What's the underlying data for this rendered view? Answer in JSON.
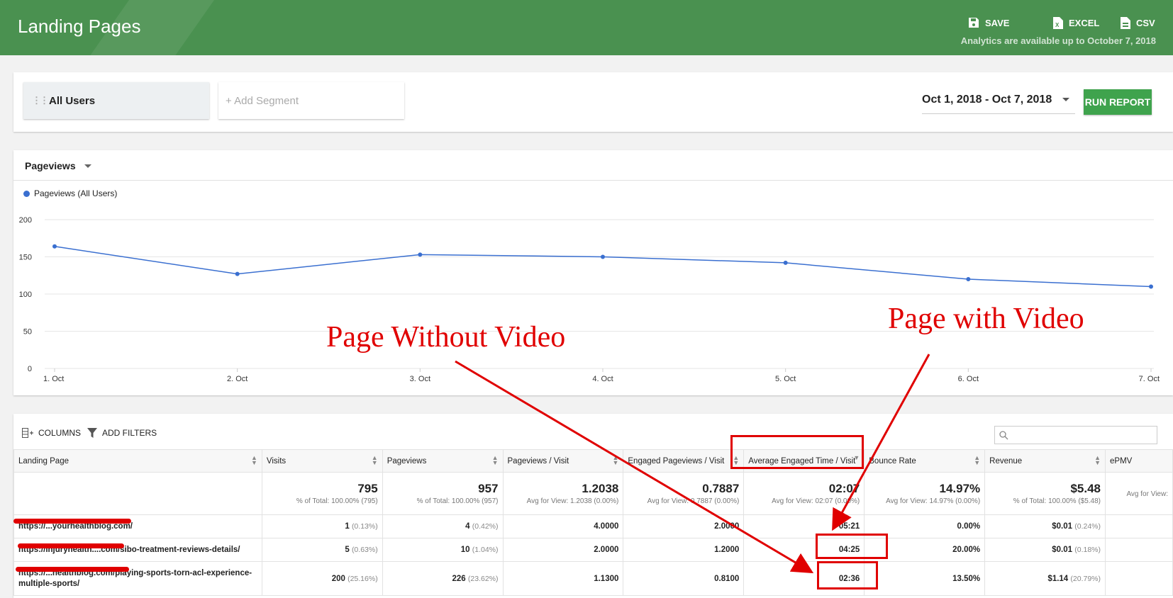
{
  "header": {
    "title": "Landing Pages",
    "save_label": "SAVE",
    "excel_label": "EXCEL",
    "csv_label": "CSV",
    "availability": "Analytics are available up to October 7, 2018"
  },
  "segments": {
    "active": "All Users",
    "add": "+ Add Segment"
  },
  "date_range": "Oct 1, 2018 - Oct 7, 2018",
  "run_report_label": "RUN REPORT",
  "chart_panel": {
    "metric": "Pageviews",
    "legend": "Pageviews (All Users)"
  },
  "chart_data": {
    "type": "line",
    "categories": [
      "1. Oct",
      "2. Oct",
      "3. Oct",
      "4. Oct",
      "5. Oct",
      "6. Oct",
      "7. Oct"
    ],
    "series": [
      {
        "name": "Pageviews (All Users)",
        "values": [
          164,
          127,
          153,
          150,
          142,
          120,
          110
        ],
        "color": "#3a6fd0"
      }
    ],
    "yticks": [
      "0",
      "50",
      "100",
      "150",
      "200"
    ],
    "ylim": [
      0,
      200
    ],
    "grid": true
  },
  "table_toolbar": {
    "columns_label": "COLUMNS",
    "filters_label": "ADD FILTERS"
  },
  "table": {
    "headers": [
      "Landing Page",
      "Visits",
      "Pageviews",
      "Pageviews / Visit",
      "Engaged Pageviews / Visit",
      "Average Engaged Time / Visit",
      "Bounce Rate",
      "Revenue",
      "ePMV"
    ],
    "totals": [
      {
        "big": "",
        "small": ""
      },
      {
        "big": "795",
        "small": "% of Total: 100.00% (795)"
      },
      {
        "big": "957",
        "small": "% of Total: 100.00% (957)"
      },
      {
        "big": "1.2038",
        "small": "Avg for View: 1.2038 (0.00%)"
      },
      {
        "big": "0.7887",
        "small": "Avg for View: 0.7887 (0.00%)"
      },
      {
        "big": "02:07",
        "small": "Avg for View: 02:07 (0.00%)"
      },
      {
        "big": "14.97%",
        "small": "Avg for View: 14.97% (0.00%)"
      },
      {
        "big": "$5.48",
        "small": "% of Total: 100.00% ($5.48)"
      },
      {
        "big": "",
        "small": "Avg for View:"
      }
    ],
    "rows": [
      {
        "page": "https://...yourhealthblog.com/",
        "visits": "1",
        "visits_pct": "(0.13%)",
        "pageviews": "4",
        "pageviews_pct": "(0.42%)",
        "pv_visit": "4.0000",
        "engaged_pv": "2.0000",
        "engaged_time": "05:21",
        "bounce": "0.00%",
        "revenue": "$0.01",
        "revenue_pct": "(0.24%)"
      },
      {
        "page": "https://injuryhealth....com/sibo-treatment-reviews-details/",
        "visits": "5",
        "visits_pct": "(0.63%)",
        "pageviews": "10",
        "pageviews_pct": "(1.04%)",
        "pv_visit": "2.0000",
        "engaged_pv": "1.2000",
        "engaged_time": "04:25",
        "bounce": "20.00%",
        "revenue": "$0.01",
        "revenue_pct": "(0.18%)"
      },
      {
        "page": "https://...healthblog.com/playing-sports-torn-acl-experience-multiple-sports/",
        "visits": "200",
        "visits_pct": "(25.16%)",
        "pageviews": "226",
        "pageviews_pct": "(23.62%)",
        "pv_visit": "1.1300",
        "engaged_pv": "0.8100",
        "engaged_time": "02:36",
        "bounce": "13.50%",
        "revenue": "$1.14",
        "revenue_pct": "(20.79%)"
      }
    ]
  },
  "annotations": {
    "without_video": "Page Without Video",
    "with_video": "Page with Video",
    "color": "#e00000"
  }
}
